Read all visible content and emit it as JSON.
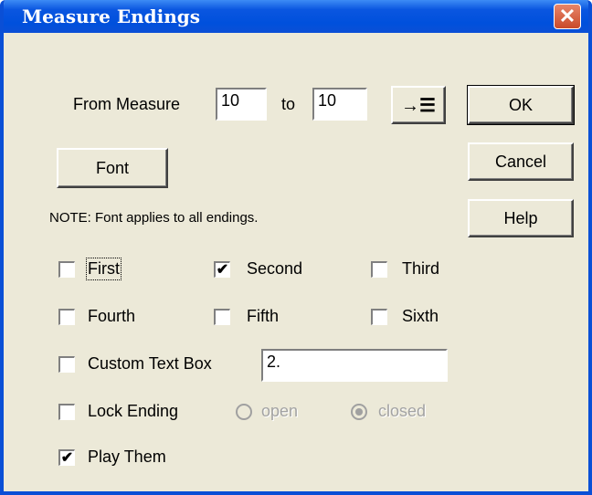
{
  "window": {
    "title": "Measure Endings",
    "close_glyph": "✕"
  },
  "range": {
    "from_label": "From Measure",
    "from_value": "10",
    "to_label": "to",
    "to_value": "10",
    "arrow_button_icon": "arrow-to-list-icon",
    "arrow_glyph": "→☰"
  },
  "buttons": {
    "ok": "OK",
    "cancel": "Cancel",
    "help": "Help",
    "font": "Font"
  },
  "note": "NOTE: Font applies to all endings.",
  "endings": [
    {
      "label": "First",
      "checked": false
    },
    {
      "label": "Second",
      "checked": true
    },
    {
      "label": "Third",
      "checked": false
    },
    {
      "label": "Fourth",
      "checked": false
    },
    {
      "label": "Fifth",
      "checked": false
    },
    {
      "label": "Sixth",
      "checked": false
    }
  ],
  "custom": {
    "label": "Custom Text Box",
    "checked": false,
    "value": "2."
  },
  "lock": {
    "label": "Lock Ending",
    "checked": false,
    "open_label": "open",
    "closed_label": "closed",
    "selected": "closed"
  },
  "play": {
    "label": "Play Them",
    "checked": true
  },
  "check_glyph": "✔"
}
